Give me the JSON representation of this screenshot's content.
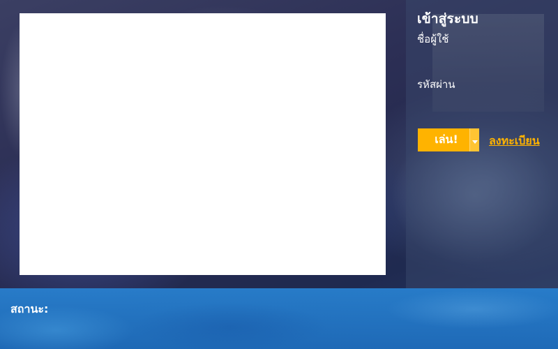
{
  "login": {
    "title": "เข้าสู่ระบบ",
    "username_label": "ชื่อผู้ใช้",
    "username_value": "",
    "password_label": "รหัสผ่าน",
    "password_value": "",
    "play_label": "เล่น!",
    "dropdown_icon": "caret-down-icon",
    "register_label": "ลงทะเบียน"
  },
  "status": {
    "label": "สถานะ:"
  },
  "colors": {
    "accent": "#ffb300",
    "status_bar": "#2882d2",
    "news_panel": "#ffffff"
  }
}
